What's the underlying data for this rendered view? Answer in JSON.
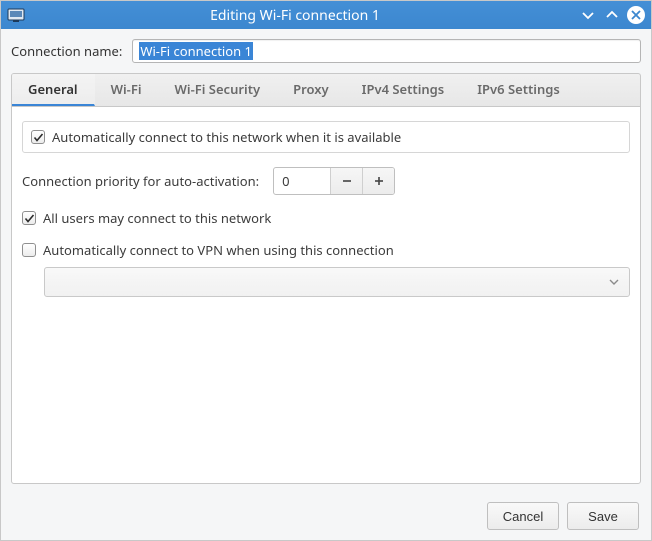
{
  "window": {
    "title": "Editing Wi-Fi connection 1"
  },
  "form": {
    "connection_name_label": "Connection name:",
    "connection_name_value": "Wi-Fi connection 1"
  },
  "tabs": [
    {
      "label": "General"
    },
    {
      "label": "Wi-Fi"
    },
    {
      "label": "Wi-Fi Security"
    },
    {
      "label": "Proxy"
    },
    {
      "label": "IPv4 Settings"
    },
    {
      "label": "IPv6 Settings"
    }
  ],
  "general": {
    "auto_connect_label": "Automatically connect to this network when it is available",
    "auto_connect_checked": true,
    "priority_label": "Connection priority for auto-activation:",
    "priority_value": "0",
    "all_users_label": "All users may connect to this network",
    "all_users_checked": true,
    "vpn_label": "Automatically connect to VPN when using this connection",
    "vpn_checked": false,
    "vpn_selected": ""
  },
  "buttons": {
    "cancel": "Cancel",
    "save": "Save"
  }
}
